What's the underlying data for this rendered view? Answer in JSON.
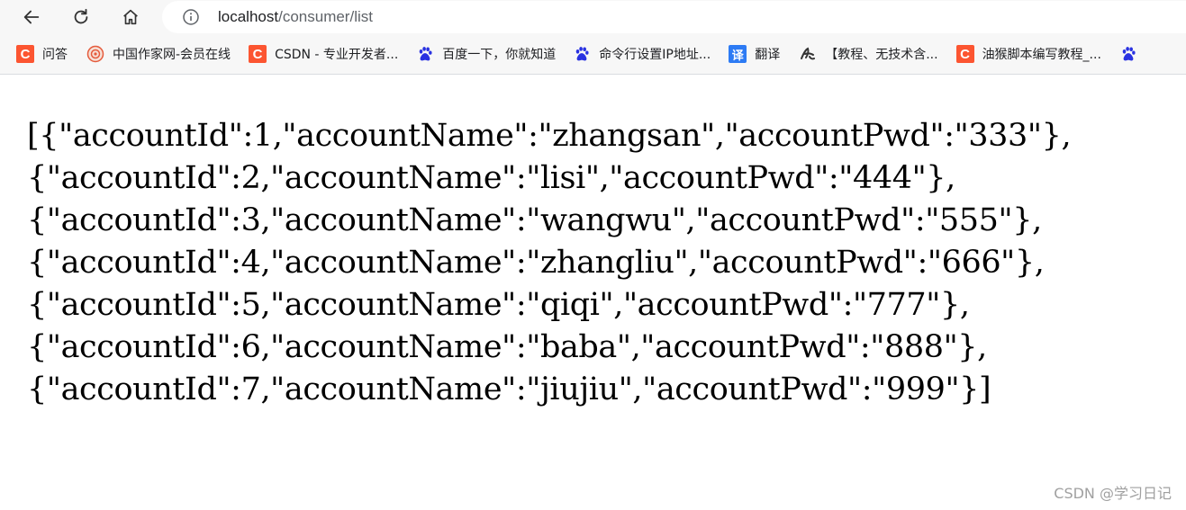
{
  "browser": {
    "url_host": "localhost",
    "url_path": "/consumer/list",
    "back_icon": "arrow-left-icon",
    "reload_icon": "reload-icon",
    "home_icon": "home-icon",
    "info_icon": "info-icon"
  },
  "bookmarks": [
    {
      "label": "问答",
      "icon": "csdn-icon"
    },
    {
      "label": "中国作家网-会员在线",
      "icon": "chinawriter-icon"
    },
    {
      "label": "CSDN - 专业开发者...",
      "icon": "csdn-icon"
    },
    {
      "label": "百度一下，你就知道",
      "icon": "baidu-paw-icon"
    },
    {
      "label": "命令行设置IP地址...",
      "icon": "baidu-paw-icon"
    },
    {
      "label": "翻译",
      "icon": "fanyi-icon"
    },
    {
      "label": "【教程、无技术含...",
      "icon": "script-logo-icon"
    },
    {
      "label": "油猴脚本编写教程_...",
      "icon": "csdn-icon"
    }
  ],
  "bookmark_overflow_icon": "baidu-paw-icon",
  "json_lines": [
    "[{\"accountId\":1,\"accountName\":\"zhangsan\",\"accountPwd\":\"333\"},",
    "{\"accountId\":2,\"accountName\":\"lisi\",\"accountPwd\":\"444\"},",
    "{\"accountId\":3,\"accountName\":\"wangwu\",\"accountPwd\":\"555\"},",
    "{\"accountId\":4,\"accountName\":\"zhangliu\",\"accountPwd\":\"666\"},",
    "{\"accountId\":5,\"accountName\":\"qiqi\",\"accountPwd\":\"777\"},",
    "{\"accountId\":6,\"accountName\":\"baba\",\"accountPwd\":\"888\"},",
    "{\"accountId\":7,\"accountName\":\"jiujiu\",\"accountPwd\":\"999\"}]"
  ],
  "watermark": "CSDN @学习日记",
  "colors": {
    "csdn_red": "#fc5531",
    "baidu_blue": "#2932e1",
    "fanyi_blue": "#2d7bf4"
  }
}
